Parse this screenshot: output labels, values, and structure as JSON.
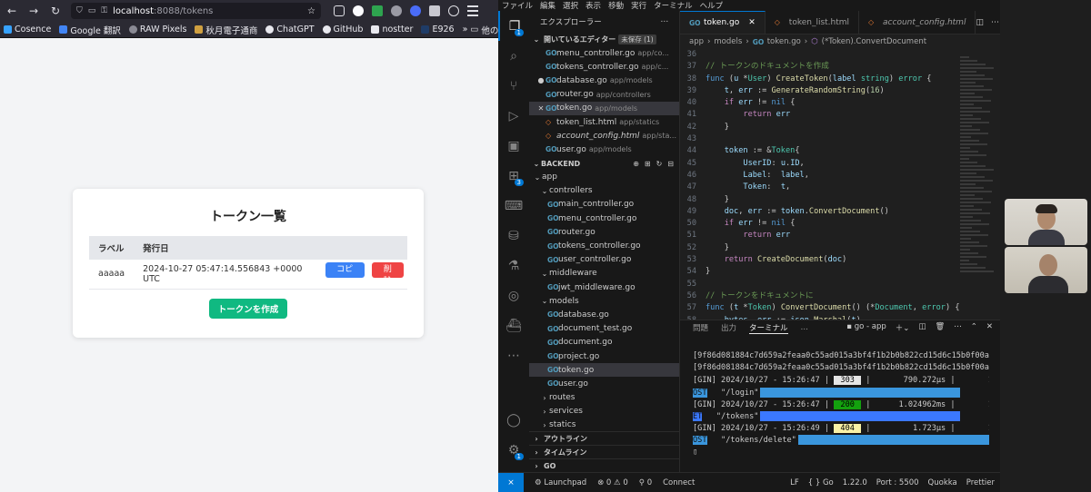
{
  "browser": {
    "url_host": "localhost",
    "url_rest": ":8088/tokens",
    "bookmarks": [
      "Cosence",
      "Google 翻訳",
      "RAW Pixels",
      "秋月電子通商",
      "ChatGPT",
      "GitHub",
      "nostter",
      "E926",
      "他のブックマーク"
    ],
    "page": {
      "title": "トークン一覧",
      "columns": [
        "ラベル",
        "発行日"
      ],
      "rows": [
        {
          "label": "aaaaa",
          "issued": "2024-10-27 05:47:14.556843 +0000 UTC",
          "copy": "コピー",
          "delete": "削除"
        }
      ],
      "create_button": "トークンを作成"
    }
  },
  "vscode": {
    "menu": [
      "ファイル",
      "編集",
      "選択",
      "表示",
      "移動",
      "実行",
      "ターミナル",
      "ヘルプ"
    ],
    "activity_badges": {
      "explorer": "1",
      "extensions": "3"
    },
    "explorer_title": "エクスプローラー",
    "open_editors": {
      "label": "開いているエディター",
      "unsaved": "未保存 (1)",
      "items": [
        {
          "name": "menu_controller.go",
          "path": "app/co...",
          "type": "go"
        },
        {
          "name": "tokens_controller.go",
          "path": "app/c...",
          "type": "go"
        },
        {
          "name": "database.go",
          "path": "app/models",
          "type": "go",
          "mark": "●"
        },
        {
          "name": "router.go",
          "path": "app/controllers",
          "type": "go"
        },
        {
          "name": "token.go",
          "path": "app/models",
          "type": "go",
          "mark": "✕",
          "selected": true
        },
        {
          "name": "token_list.html",
          "path": "app/statics",
          "type": "html"
        },
        {
          "name": "account_config.html",
          "path": "app/sta...",
          "type": "html",
          "italic": true
        },
        {
          "name": "user.go",
          "path": "app/models",
          "type": "go"
        }
      ]
    },
    "tree": {
      "root": "BACKEND",
      "items": [
        {
          "name": "app",
          "indent": 1,
          "kind": "folder"
        },
        {
          "name": "controllers",
          "indent": 2,
          "kind": "folder"
        },
        {
          "name": "main_controller.go",
          "indent": 3,
          "kind": "go"
        },
        {
          "name": "menu_controller.go",
          "indent": 3,
          "kind": "go"
        },
        {
          "name": "router.go",
          "indent": 3,
          "kind": "go"
        },
        {
          "name": "tokens_controller.go",
          "indent": 3,
          "kind": "go"
        },
        {
          "name": "user_controller.go",
          "indent": 3,
          "kind": "go"
        },
        {
          "name": "middleware",
          "indent": 2,
          "kind": "folder"
        },
        {
          "name": "jwt_middleware.go",
          "indent": 3,
          "kind": "go"
        },
        {
          "name": "models",
          "indent": 2,
          "kind": "folder"
        },
        {
          "name": "database.go",
          "indent": 3,
          "kind": "go"
        },
        {
          "name": "document_test.go",
          "indent": 3,
          "kind": "go"
        },
        {
          "name": "document.go",
          "indent": 3,
          "kind": "go"
        },
        {
          "name": "project.go",
          "indent": 3,
          "kind": "go"
        },
        {
          "name": "token.go",
          "indent": 3,
          "kind": "go",
          "selected": true
        },
        {
          "name": "user.go",
          "indent": 3,
          "kind": "go"
        },
        {
          "name": "routes",
          "indent": 2,
          "kind": "folder-closed"
        },
        {
          "name": "services",
          "indent": 2,
          "kind": "folder-closed"
        },
        {
          "name": "statics",
          "indent": 2,
          "kind": "folder-closed"
        }
      ]
    },
    "bottom_sections": [
      "アウトライン",
      "タイムライン",
      "GO"
    ],
    "tabs": [
      {
        "name": "token.go",
        "type": "go",
        "active": true
      },
      {
        "name": "token_list.html",
        "type": "html"
      },
      {
        "name": "account_config.html",
        "type": "html",
        "italic": true
      }
    ],
    "breadcrumb": [
      "app",
      "models",
      "token.go",
      "(*Token).ConvertDocument"
    ],
    "code_start_line": 36,
    "code_lines": [
      [],
      [
        [
          "c",
          "// トークンのドキュメントを作成"
        ]
      ],
      [
        [
          "kw",
          "func"
        ],
        [
          "ct",
          " ("
        ],
        [
          "v",
          "u"
        ],
        [
          "ct",
          " *"
        ],
        [
          "t",
          "User"
        ],
        [
          "ct",
          ") "
        ],
        [
          "f",
          "CreateToken"
        ],
        [
          "ct",
          "("
        ],
        [
          "v",
          "label"
        ],
        [
          "ct",
          " "
        ],
        [
          "t",
          "string"
        ],
        [
          "ct",
          ") "
        ],
        [
          "t",
          "error"
        ],
        [
          "ct",
          " {"
        ]
      ],
      [
        [
          "ct",
          "    "
        ],
        [
          "v",
          "t"
        ],
        [
          "ct",
          ", "
        ],
        [
          "v",
          "err"
        ],
        [
          "ct",
          " := "
        ],
        [
          "f",
          "GenerateRandomString"
        ],
        [
          "ct",
          "("
        ],
        [
          "n",
          "16"
        ],
        [
          "ct",
          ")"
        ]
      ],
      [
        [
          "ct",
          "    "
        ],
        [
          "k",
          "if"
        ],
        [
          "ct",
          " "
        ],
        [
          "v",
          "err"
        ],
        [
          "ct",
          " != "
        ],
        [
          "kw",
          "nil"
        ],
        [
          "ct",
          " {"
        ]
      ],
      [
        [
          "ct",
          "        "
        ],
        [
          "k",
          "return"
        ],
        [
          "ct",
          " "
        ],
        [
          "v",
          "err"
        ]
      ],
      [
        [
          "ct",
          "    }"
        ]
      ],
      [
        [
          "ct",
          ""
        ]
      ],
      [
        [
          "ct",
          "    "
        ],
        [
          "v",
          "token"
        ],
        [
          "ct",
          " := &"
        ],
        [
          "t",
          "Token"
        ],
        [
          "ct",
          "{"
        ]
      ],
      [
        [
          "ct",
          "        "
        ],
        [
          "v",
          "UserID"
        ],
        [
          "ct",
          ": "
        ],
        [
          "v",
          "u"
        ],
        [
          "ct",
          "."
        ],
        [
          "v",
          "ID"
        ],
        [
          "ct",
          ","
        ]
      ],
      [
        [
          "ct",
          "        "
        ],
        [
          "v",
          "Label"
        ],
        [
          "ct",
          ":  "
        ],
        [
          "v",
          "label"
        ],
        [
          "ct",
          ","
        ]
      ],
      [
        [
          "ct",
          "        "
        ],
        [
          "v",
          "Token"
        ],
        [
          "ct",
          ":  "
        ],
        [
          "v",
          "t"
        ],
        [
          "ct",
          ","
        ]
      ],
      [
        [
          "ct",
          "    }"
        ]
      ],
      [
        [
          "ct",
          "    "
        ],
        [
          "v",
          "doc"
        ],
        [
          "ct",
          ", "
        ],
        [
          "v",
          "err"
        ],
        [
          "ct",
          " := "
        ],
        [
          "v",
          "token"
        ],
        [
          "ct",
          "."
        ],
        [
          "f",
          "ConvertDocument"
        ],
        [
          "ct",
          "()"
        ]
      ],
      [
        [
          "ct",
          "    "
        ],
        [
          "k",
          "if"
        ],
        [
          "ct",
          " "
        ],
        [
          "v",
          "err"
        ],
        [
          "ct",
          " != "
        ],
        [
          "kw",
          "nil"
        ],
        [
          "ct",
          " {"
        ]
      ],
      [
        [
          "ct",
          "        "
        ],
        [
          "k",
          "return"
        ],
        [
          "ct",
          " "
        ],
        [
          "v",
          "err"
        ]
      ],
      [
        [
          "ct",
          "    }"
        ]
      ],
      [
        [
          "ct",
          "    "
        ],
        [
          "k",
          "return"
        ],
        [
          "ct",
          " "
        ],
        [
          "f",
          "CreateDocument"
        ],
        [
          "ct",
          "("
        ],
        [
          "v",
          "doc"
        ],
        [
          "ct",
          ")"
        ]
      ],
      [
        [
          "ct",
          "}"
        ]
      ],
      [
        [
          "ct",
          ""
        ]
      ],
      [
        [
          "c",
          "// トークンをドキュメントに"
        ]
      ],
      [
        [
          "kw",
          "func"
        ],
        [
          "ct",
          " ("
        ],
        [
          "v",
          "t"
        ],
        [
          "ct",
          " *"
        ],
        [
          "t",
          "Token"
        ],
        [
          "ct",
          ") "
        ],
        [
          "f",
          "ConvertDocument"
        ],
        [
          "ct",
          "() (*"
        ],
        [
          "t",
          "Document"
        ],
        [
          "ct",
          ", "
        ],
        [
          "t",
          "error"
        ],
        [
          "ct",
          ") {"
        ]
      ],
      [
        [
          "ct",
          "    "
        ],
        [
          "v",
          "bytes"
        ],
        [
          "ct",
          ", "
        ],
        [
          "v",
          "err"
        ],
        [
          "ct",
          " := "
        ],
        [
          "v",
          "json"
        ],
        [
          "ct",
          "."
        ],
        [
          "f",
          "Marshal"
        ],
        [
          "ct",
          "("
        ],
        [
          "v",
          "t"
        ],
        [
          "ct",
          ")"
        ]
      ],
      [
        [
          "ct",
          "    "
        ],
        [
          "k",
          "if"
        ],
        [
          "ct",
          " "
        ],
        [
          "v",
          "err"
        ],
        [
          "ct",
          " != "
        ],
        [
          "kw",
          "nil"
        ],
        [
          "ct",
          " {"
        ]
      ]
    ],
    "panel": {
      "tabs": [
        "問題",
        "出力",
        "ターミナル",
        "…"
      ],
      "active_tab": "ターミナル",
      "terminal_name": "go - app",
      "lines": [
        "[9f86d081884c7d659a2feaa0c55ad015a3bf4f1b2b0b822cd15d6c15b0f00a08]",
        "[9f86d081884c7d659a2feaa0c55ad015a3bf4f1b2b0b822cd15d6c15b0f00a08]"
      ],
      "gin": [
        {
          "prefix": "[GIN] 2024/10/27 - 15:26:47 |",
          "status": "303",
          "cls": "st303",
          "rest": "|       790.272µs |       127.0.0.1 |",
          "method": "OST",
          "path": "   \"/login\""
        },
        {
          "prefix": "[GIN] 2024/10/27 - 15:26:47 |",
          "status": "200",
          "cls": "st200",
          "rest": "|      1.024962ms |       127.0.0.1 |",
          "method": "ET",
          "path": "   \"/tokens\""
        },
        {
          "prefix": "[GIN] 2024/10/27 - 15:26:49 |",
          "status": "404",
          "cls": "st404",
          "rest": "|         1.723µs |       127.0.0.1 |",
          "method": "OST",
          "path": "   \"/tokens/delete\""
        }
      ]
    },
    "status": {
      "left": [
        "⊗ 0 ⚠ 0",
        "⚲ 0",
        "Connect",
        "Launchpad"
      ],
      "right": [
        "LF",
        "Go",
        "1.22.0",
        "Port : 5500",
        "Quokka",
        "Prettier"
      ]
    }
  },
  "colors": {
    "copy": "#3b82f6",
    "delete": "#ef4444",
    "create": "#10b981",
    "vscode_accent": "#0078d4"
  }
}
